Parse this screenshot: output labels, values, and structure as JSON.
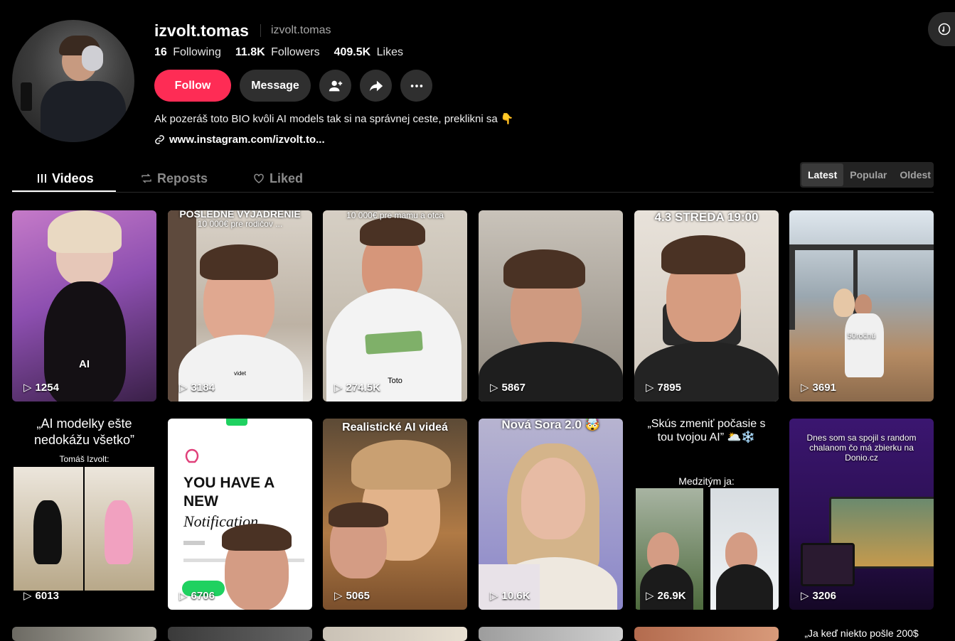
{
  "profile": {
    "username": "izvolt.tomas",
    "handle": "izvolt.tomas",
    "stats": [
      {
        "value": "16",
        "label": "Following"
      },
      {
        "value": "11.8K",
        "label": "Followers"
      },
      {
        "value": "409.5K",
        "label": "Likes"
      }
    ],
    "follow_label": "Follow",
    "message_label": "Message",
    "bio": "Ak pozeráš toto BIO kvôli AI models tak si na správnej ceste, preklikni sa 👇",
    "link": "www.instagram.com/izvolt.to..."
  },
  "tabs": [
    {
      "label": "Videos",
      "icon": "grid-icon",
      "active": true
    },
    {
      "label": "Reposts",
      "icon": "repost-icon",
      "active": false
    },
    {
      "label": "Liked",
      "icon": "liked-heart-icon",
      "active": false
    }
  ],
  "sort": [
    "Latest",
    "Popular",
    "Oldest"
  ],
  "sort_selected": "Latest",
  "videos": [
    {
      "views": "1254",
      "captions": [
        "AI"
      ]
    },
    {
      "views": "3184",
      "captions": [
        "POSLEDNÉ VYJADRENIE",
        "10 000€ pre rodičov ...",
        "videt"
      ]
    },
    {
      "views": "274.5K",
      "captions": [
        "10 000€ pre mamu a otca",
        "Toto"
      ]
    },
    {
      "views": "5867",
      "captions": []
    },
    {
      "views": "7895",
      "captions": [
        "4.3 STREDA 19:00"
      ]
    },
    {
      "views": "3691",
      "captions": [
        "50ročnú"
      ]
    },
    {
      "views": "6013",
      "captions": [
        "„AI modelky ešte nedokážu všetko”",
        "Tomáš Izvolt:"
      ]
    },
    {
      "views": "6706",
      "captions": [
        "YOU HAVE A NEW",
        "Notification"
      ]
    },
    {
      "views": "5065",
      "captions": [
        "Realistické AI videá"
      ]
    },
    {
      "views": "10.6K",
      "captions": [
        "Nová Sora 2.0 🤯"
      ]
    },
    {
      "views": "26.9K",
      "captions": [
        "„Skús zmeniť počasie s tou tvojou AI” 🌥️❄️",
        "Medzitým ja:"
      ]
    },
    {
      "views": "3206",
      "captions": [
        "Dnes som sa spojil s random chalanom čo má zbierku na Donio.cz"
      ]
    },
    {
      "captions": []
    },
    {
      "captions": []
    },
    {
      "captions": []
    },
    {
      "captions": []
    },
    {
      "captions": []
    },
    {
      "captions": [
        "„Ja keď niekto pošle 200$"
      ]
    }
  ]
}
